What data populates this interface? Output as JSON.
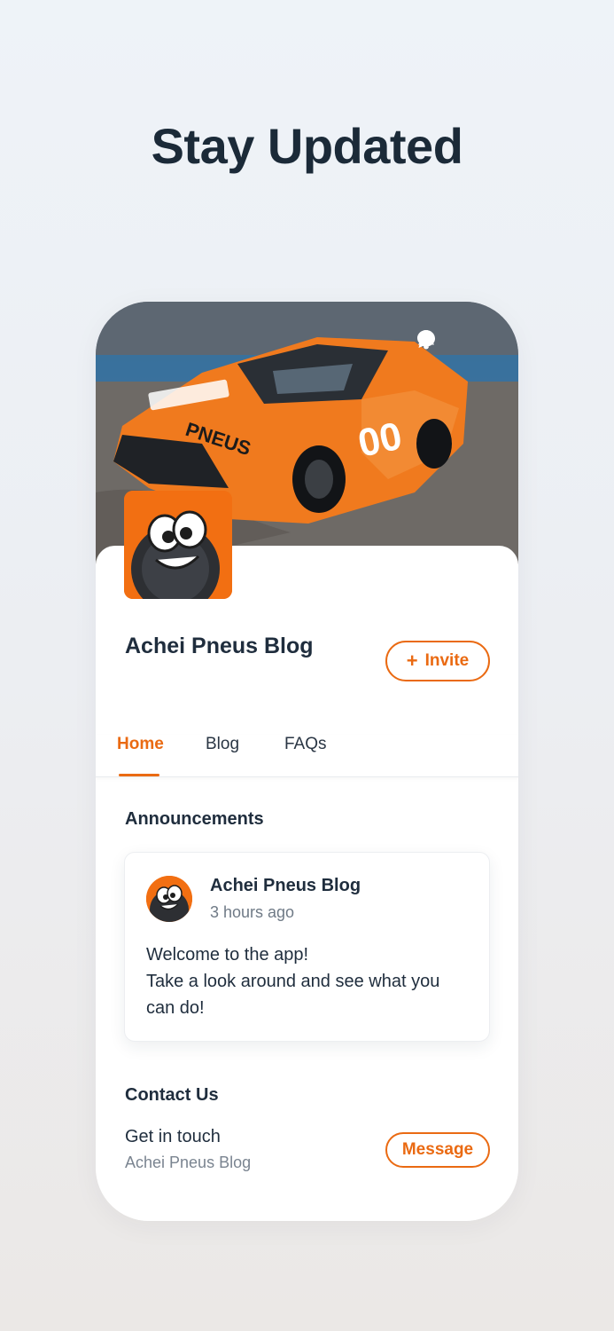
{
  "headline": "Stay Updated",
  "hero": {
    "icons": [
      "chat-icon",
      "bell-icon"
    ],
    "car_livery": [
      "PNEUS",
      "00"
    ]
  },
  "site": {
    "title": "Achei Pneus Blog",
    "invite_label": "Invite",
    "invite_icon": "plus-icon"
  },
  "tabs": [
    {
      "label": "Home",
      "active": true
    },
    {
      "label": "Blog",
      "active": false
    },
    {
      "label": "FAQs",
      "active": false
    }
  ],
  "announcements": {
    "title": "Announcements",
    "post": {
      "author": "Achei Pneus Blog",
      "time": "3 hours ago",
      "body_lines": [
        "Welcome to the app!",
        "Take a look around and see what you",
        "can do!"
      ]
    }
  },
  "contact": {
    "title": "Contact Us",
    "line": "Get in touch",
    "sub": "Achei Pneus Blog",
    "message_label": "Message"
  },
  "colors": {
    "accent": "#ea6a12",
    "text": "#1f2d3d",
    "muted": "#6f7a86"
  }
}
